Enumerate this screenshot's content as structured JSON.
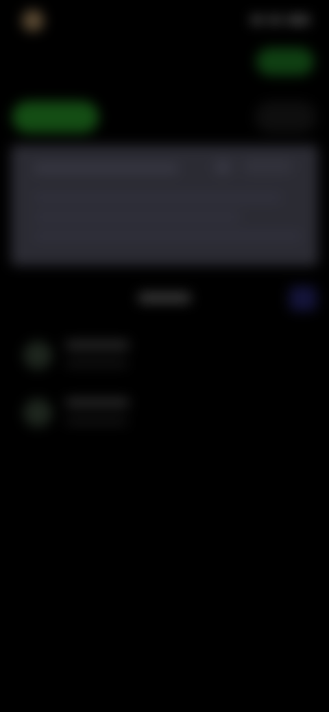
{
  "theme": {
    "background": "#000000",
    "accent_green": "#144d14",
    "card_background": "#2b2b33",
    "blue_button": "#14143a"
  },
  "status_bar": {
    "time": "",
    "icons": [
      "signal-icon",
      "wifi-icon",
      "battery-icon"
    ]
  },
  "header": {
    "title": "",
    "action_label": ""
  },
  "tabs": [
    {
      "label": ""
    },
    {
      "label": ""
    },
    {
      "label": ""
    }
  ],
  "card": {
    "title": "",
    "lines": [
      "",
      "",
      ""
    ]
  },
  "section": {
    "title": ""
  },
  "list": [
    {
      "name": "",
      "subtitle": ""
    },
    {
      "name": "",
      "subtitle": ""
    }
  ]
}
